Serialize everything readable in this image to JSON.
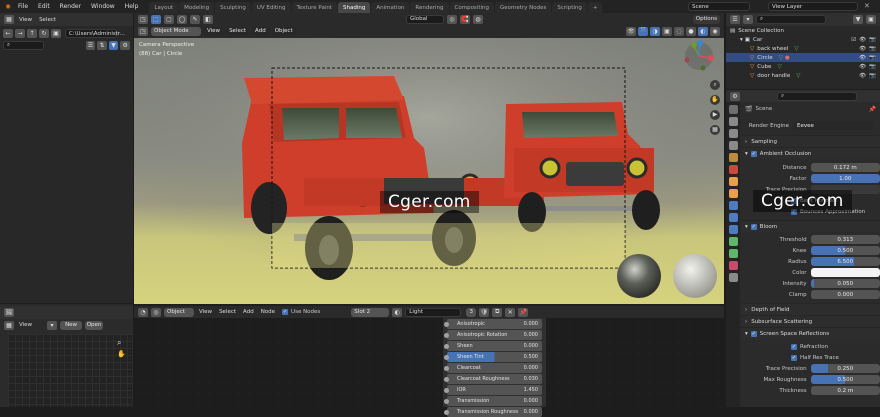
{
  "topbar": {
    "menus": [
      "File",
      "Edit",
      "Render",
      "Window",
      "Help"
    ],
    "workspaces": [
      "Layout",
      "Modeling",
      "Sculpting",
      "UV Editing",
      "Texture Paint",
      "Shading",
      "Animation",
      "Rendering",
      "Compositing",
      "Geometry Nodes",
      "Scripting"
    ],
    "active_workspace": "Shading",
    "add_tab": "+",
    "scene_label": "Scene",
    "view_layer_label": "View Layer"
  },
  "file_browser": {
    "view": "View",
    "select": "Select",
    "path": "C:\\Users\\Administr..."
  },
  "viewport": {
    "mode": "Object Mode",
    "menus": [
      "View",
      "Select",
      "Add",
      "Object"
    ],
    "transform": "Global",
    "options": "Options",
    "overlay_title": "Camera Perspective",
    "overlay_sub": "(88) Car | Circle"
  },
  "watermark": "Cger.com",
  "image_editor": {
    "view": "View",
    "new": "New",
    "open": "Open"
  },
  "node_editor": {
    "type": "Object",
    "menus": [
      "View",
      "Select",
      "Add",
      "Node"
    ],
    "use_nodes": "Use Nodes",
    "slot": "Slot 2",
    "material": "Light",
    "user_count": "3",
    "rows": [
      {
        "label": "Anisotropic",
        "value": "0.000",
        "highlight": false
      },
      {
        "label": "Anisotropic Rotation",
        "value": "0.000",
        "highlight": false
      },
      {
        "label": "Sheen",
        "value": "0.000",
        "highlight": false
      },
      {
        "label": "Sheen Tint",
        "value": "0.500",
        "highlight": true
      },
      {
        "label": "Clearcoat",
        "value": "0.000",
        "highlight": false
      },
      {
        "label": "Clearcoat Roughness",
        "value": "0.030",
        "highlight": false
      },
      {
        "label": "IOR",
        "value": "1.450",
        "highlight": false
      },
      {
        "label": "Transmission",
        "value": "0.000",
        "highlight": false
      },
      {
        "label": "Transmission Roughness",
        "value": "0.000",
        "highlight": false
      }
    ]
  },
  "outliner": {
    "root": "Scene Collection",
    "items": [
      {
        "label": "Car",
        "indent": 1,
        "selected": false
      },
      {
        "label": "back wheel",
        "indent": 2,
        "selected": false
      },
      {
        "label": "Circle",
        "indent": 2,
        "selected": true
      },
      {
        "label": "Cube",
        "indent": 2,
        "selected": false
      },
      {
        "label": "door handle",
        "indent": 2,
        "selected": false
      }
    ]
  },
  "properties": {
    "breadcrumb": "Scene",
    "render_engine_label": "Render Engine",
    "render_engine": "Eevee",
    "sampling": "Sampling",
    "ao": {
      "title": "Ambient Occlusion",
      "distance_label": "Distance",
      "distance": "0.172 m",
      "factor_label": "Factor",
      "factor": "1.00",
      "trace_precision_label": "Trace Precision",
      "bent_normals": "Bent Normals",
      "bounces": "Bounces Approximation"
    },
    "bloom": {
      "title": "Bloom",
      "threshold_label": "Threshold",
      "threshold": "0.313",
      "knee_label": "Knee",
      "knee": "0.500",
      "radius_label": "Radius",
      "radius": "6.500",
      "color_label": "Color",
      "intensity_label": "Intensity",
      "intensity": "0.050",
      "clamp_label": "Clamp",
      "clamp": "0.000"
    },
    "dof": "Depth of Field",
    "sss": "Subsurface Scattering",
    "ssr": {
      "title": "Screen Space Reflections",
      "refraction": "Refraction",
      "half_res": "Half Res Trace",
      "trace_precision_label": "Trace Precision",
      "trace_precision": "0.250",
      "max_roughness_label": "Max Roughness",
      "max_roughness": "0.500",
      "thickness_label": "Thickness",
      "thickness": "0.2 m"
    }
  },
  "colors": {
    "accent": "#4772b3",
    "selection": "#334d80",
    "header": "#303030",
    "car_red": "#d2402a",
    "floor_yellow": "#d6d37e"
  }
}
